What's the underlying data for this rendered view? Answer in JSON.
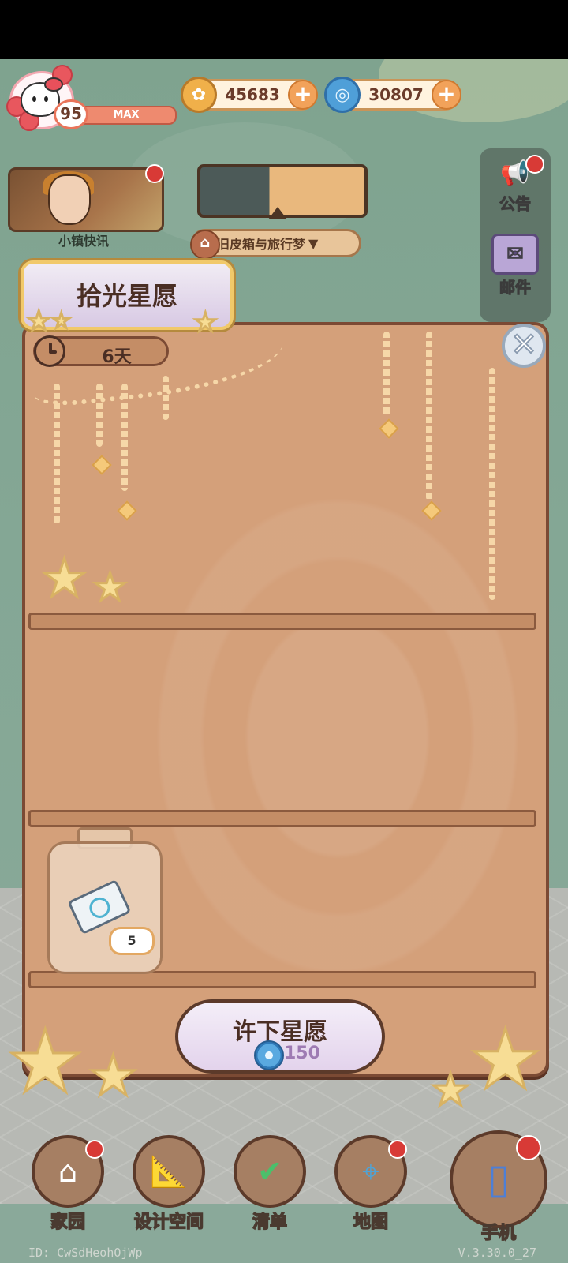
{
  "player": {
    "level": "95",
    "xp_label": "MAX"
  },
  "currencies": [
    {
      "name": "coin-currency",
      "value": "45683",
      "icon": "coin-icon",
      "color": "#f0b04a"
    },
    {
      "name": "gem-currency",
      "value": "30807",
      "icon": "swirl-gem-icon",
      "color": "#4f9fd8"
    }
  ],
  "news": {
    "label": "小镇快讯"
  },
  "event": {
    "label": "旧皮箱与旅行梦"
  },
  "side": {
    "notice": "公告",
    "mail": "邮件"
  },
  "modal": {
    "title": "拾光星愿",
    "timer": "6天",
    "jar_count": "5",
    "wish_label": "许下星愿",
    "wish_cost": "150"
  },
  "nav": {
    "home": "家园",
    "design": "设计空间",
    "list": "清单",
    "map": "地图",
    "phone": "手机"
  },
  "footer": {
    "id": "ID: CwSdHeohOjWp",
    "version": "V.3.30.0_27"
  },
  "colors": {
    "wood": "#d4a07a",
    "border": "#7b4a34",
    "bg_green": "#84a795"
  }
}
